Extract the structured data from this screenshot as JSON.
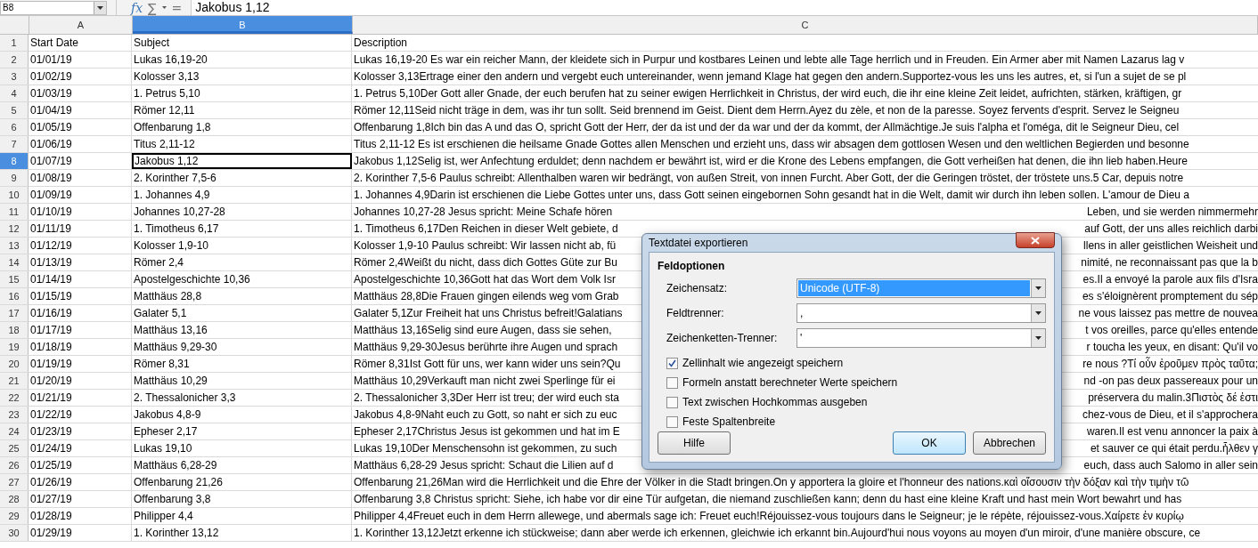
{
  "name_box": "B8",
  "formula_tools": [
    "fx",
    "∑",
    "="
  ],
  "formula": "Jakobus 1,12",
  "columns": [
    {
      "label": "A",
      "selected": false
    },
    {
      "label": "B",
      "selected": true
    },
    {
      "label": "C",
      "selected": false
    }
  ],
  "rows": [
    {
      "number": "1",
      "selected": false,
      "cells": [
        {
          "text": "Start Date",
          "selected": false
        },
        {
          "text": "Subject",
          "selected": false
        }
      ],
      "description": [
        "Description"
      ]
    },
    {
      "number": "2",
      "selected": false,
      "cells": [
        {
          "text": "01/01/19",
          "selected": false
        },
        {
          "text": "Lukas 16,19-20",
          "selected": false
        }
      ],
      "description": [
        "Lukas 16,19-20 Es war ein reicher Mann, der kleidete sich in Purpur und kostbares Leinen und lebte alle Tage herrlich und in Freuden. Ein Armer aber mit Namen Lazarus lag v"
      ]
    },
    {
      "number": "3",
      "selected": false,
      "cells": [
        {
          "text": "01/02/19",
          "selected": false
        },
        {
          "text": "Kolosser 3,13",
          "selected": false
        }
      ],
      "description": [
        "Kolosser 3,13Ertrage einer den andern und vergebt euch untereinander, wenn jemand Klage hat gegen den andern.Supportez-vous les uns les autres, et, si l'un a sujet de se pl"
      ]
    },
    {
      "number": "4",
      "selected": false,
      "cells": [
        {
          "text": "01/03/19",
          "selected": false
        },
        {
          "text": "1. Petrus 5,10",
          "selected": false
        }
      ],
      "description": [
        "1. Petrus 5,10Der Gott aller Gnade, der euch berufen hat zu seiner ewigen Herrlichkeit in Christus, der wird euch, die ihr eine kleine Zeit leidet, aufrichten, stärken, kräftigen, gr"
      ]
    },
    {
      "number": "5",
      "selected": false,
      "cells": [
        {
          "text": "01/04/19",
          "selected": false
        },
        {
          "text": "Römer 12,11",
          "selected": false
        }
      ],
      "description": [
        "Römer 12,11Seid nicht träge in dem, was ihr tun sollt. Seid brennend im Geist. Dient dem Herrn.Ayez du zèle, et non de la paresse. Soyez fervents d'esprit. Servez le Seigneu"
      ]
    },
    {
      "number": "6",
      "selected": false,
      "cells": [
        {
          "text": "01/05/19",
          "selected": false
        },
        {
          "text": "Offenbarung 1,8",
          "selected": false
        }
      ],
      "description": [
        "Offenbarung 1,8Ich bin das A und das O, spricht Gott der Herr, der da ist und der da war und der da kommt, der Allmächtige.Je suis l'alpha et l'oméga, dit le Seigneur Dieu, cel"
      ]
    },
    {
      "number": "7",
      "selected": false,
      "cells": [
        {
          "text": "01/06/19",
          "selected": false
        },
        {
          "text": "Titus 2,11-12",
          "selected": false
        }
      ],
      "description": [
        "Titus 2,11-12 Es ist erschienen die heilsame Gnade Gottes allen Menschen und erzieht uns, dass wir absagen dem gottlosen Wesen und den weltlichen Begierden und besonne"
      ]
    },
    {
      "number": "8",
      "selected": true,
      "cells": [
        {
          "text": "01/07/19",
          "selected": false
        },
        {
          "text": "Jakobus 1,12",
          "selected": true
        }
      ],
      "description": [
        "Jakobus 1,12Selig ist, wer Anfechtung erduldet; denn nachdem er bewährt ist, wird er die Krone des Lebens empfangen, die Gott verheißen hat denen, die ihn lieb haben.Heure"
      ]
    },
    {
      "number": "9",
      "selected": false,
      "cells": [
        {
          "text": "01/08/19",
          "selected": false
        },
        {
          "text": "2. Korinther 7,5-6",
          "selected": false
        }
      ],
      "description": [
        "2. Korinther 7,5-6 Paulus schreibt:  Allenthalben waren wir bedrängt, von außen Streit, von innen Furcht. Aber Gott, der die Geringen tröstet, der tröstete uns.5 Car, depuis notre"
      ]
    },
    {
      "number": "10",
      "selected": false,
      "cells": [
        {
          "text": "01/09/19",
          "selected": false
        },
        {
          "text": "1. Johannes 4,9",
          "selected": false
        }
      ],
      "description": [
        "1. Johannes 4,9Darin ist erschienen die Liebe Gottes unter uns, dass Gott seinen eingebornen Sohn gesandt hat in die Welt, damit wir durch ihn leben sollen. L'amour de Dieu a"
      ]
    },
    {
      "number": "11",
      "selected": false,
      "cells": [
        {
          "text": "01/10/19",
          "selected": false
        },
        {
          "text": "Johannes 10,27-28",
          "selected": false
        }
      ],
      "description": [
        "Johannes 10,27-28 Jesus spricht:  Meine Schafe hören",
        "Leben, und sie werden nimmermehr"
      ]
    },
    {
      "number": "12",
      "selected": false,
      "cells": [
        {
          "text": "01/11/19",
          "selected": false
        },
        {
          "text": "1. Timotheus 6,17",
          "selected": false
        }
      ],
      "description": [
        "1. Timotheus 6,17Den Reichen in dieser Welt gebiete, d",
        "auf Gott, der uns alles reichlich darbi"
      ]
    },
    {
      "number": "13",
      "selected": false,
      "cells": [
        {
          "text": "01/12/19",
          "selected": false
        },
        {
          "text": "Kolosser 1,9-10",
          "selected": false
        }
      ],
      "description": [
        "Kolosser 1,9-10 Paulus schreibt:  Wir lassen nicht ab, fü",
        "llens in aller geistlichen Weisheit und"
      ]
    },
    {
      "number": "14",
      "selected": false,
      "cells": [
        {
          "text": "01/13/19",
          "selected": false
        },
        {
          "text": "Römer 2,4",
          "selected": false
        }
      ],
      "description": [
        "Römer 2,4Weißt du nicht, dass dich Gottes Güte zur Bu",
        "nimité, ne reconnaissant pas que la b"
      ]
    },
    {
      "number": "15",
      "selected": false,
      "cells": [
        {
          "text": "01/14/19",
          "selected": false
        },
        {
          "text": "Apostelgeschichte 10,36",
          "selected": false
        }
      ],
      "description": [
        "Apostelgeschichte 10,36Gott hat das Wort dem Volk Isr",
        "es.Il a envoyé la parole aux fils d'Isra"
      ]
    },
    {
      "number": "16",
      "selected": false,
      "cells": [
        {
          "text": "01/15/19",
          "selected": false
        },
        {
          "text": "Matthäus 28,8",
          "selected": false
        }
      ],
      "description": [
        "Matthäus 28,8Die Frauen gingen eilends weg vom Grab",
        "es s'éloignèrent promptement du sép"
      ]
    },
    {
      "number": "17",
      "selected": false,
      "cells": [
        {
          "text": "01/16/19",
          "selected": false
        },
        {
          "text": "Galater 5,1",
          "selected": false
        }
      ],
      "description": [
        "Galater 5,1Zur Freiheit hat uns Christus befreit!Galatians",
        "ne vous laissez pas mettre de nouvea"
      ]
    },
    {
      "number": "18",
      "selected": false,
      "cells": [
        {
          "text": "01/17/19",
          "selected": false
        },
        {
          "text": "Matthäus 13,16",
          "selected": false
        }
      ],
      "description": [
        "Matthäus 13,16Selig sind eure Augen, dass sie sehen,",
        "t vos oreilles, parce qu'elles entende"
      ]
    },
    {
      "number": "19",
      "selected": false,
      "cells": [
        {
          "text": "01/18/19",
          "selected": false
        },
        {
          "text": "Matthäus 9,29-30",
          "selected": false
        }
      ],
      "description": [
        "Matthäus 9,29-30Jesus berührte ihre Augen und sprach",
        "r toucha les yeux, en disant: Qu'il vo"
      ]
    },
    {
      "number": "20",
      "selected": false,
      "cells": [
        {
          "text": "01/19/19",
          "selected": false
        },
        {
          "text": "Römer 8,31",
          "selected": false
        }
      ],
      "description": [
        "Römer 8,31Ist Gott für uns, wer kann wider uns sein?Qu",
        "re nous ?Τί οὖν ἐροῦμεν πρὸς ταῦτα;"
      ]
    },
    {
      "number": "21",
      "selected": false,
      "cells": [
        {
          "text": "01/20/19",
          "selected": false
        },
        {
          "text": "Matthäus 10,29",
          "selected": false
        }
      ],
      "description": [
        "Matthäus 10,29Verkauft man nicht zwei Sperlinge für ei",
        "nd -on pas deux passereaux pour un"
      ]
    },
    {
      "number": "22",
      "selected": false,
      "cells": [
        {
          "text": "01/21/19",
          "selected": false
        },
        {
          "text": "2. Thessalonicher 3,3",
          "selected": false
        }
      ],
      "description": [
        "2. Thessalonicher 3,3Der Herr ist treu; der wird euch sta",
        "préservera du malin.3Πιστὸς δέ ἐστι"
      ]
    },
    {
      "number": "23",
      "selected": false,
      "cells": [
        {
          "text": "01/22/19",
          "selected": false
        },
        {
          "text": "Jakobus 4,8-9",
          "selected": false
        }
      ],
      "description": [
        "Jakobus 4,8-9Naht euch zu Gott, so naht er sich zu euc",
        "chez-vous de Dieu, et il s'approchera"
      ]
    },
    {
      "number": "24",
      "selected": false,
      "cells": [
        {
          "text": "01/23/19",
          "selected": false
        },
        {
          "text": "Epheser 2,17",
          "selected": false
        }
      ],
      "description": [
        "Epheser 2,17Christus Jesus ist gekommen und hat im E",
        "waren.Il est venu annoncer la paix à"
      ]
    },
    {
      "number": "25",
      "selected": false,
      "cells": [
        {
          "text": "01/24/19",
          "selected": false
        },
        {
          "text": "Lukas 19,10",
          "selected": false
        }
      ],
      "description": [
        "Lukas 19,10Der Menschensohn ist gekommen, zu such",
        "et sauver ce qui était perdu.ἦλθεν γ"
      ]
    },
    {
      "number": "26",
      "selected": false,
      "cells": [
        {
          "text": "01/25/19",
          "selected": false
        },
        {
          "text": "Matthäus 6,28-29",
          "selected": false
        }
      ],
      "description": [
        "Matthäus 6,28-29 Jesus spricht:  Schaut die Lilien auf d",
        "euch, dass auch Salomo in aller sein"
      ]
    },
    {
      "number": "27",
      "selected": false,
      "cells": [
        {
          "text": "01/26/19",
          "selected": false
        },
        {
          "text": "Offenbarung 21,26",
          "selected": false
        }
      ],
      "description": [
        "Offenbarung 21,26Man wird die Herrlichkeit und die Ehre der Völker in die Stadt bringen.On y apportera la gloire et l'honneur des nations.καὶ οἴσουσιν τὴν δόξαν καὶ τὴν τιμὴν τῶ"
      ]
    },
    {
      "number": "28",
      "selected": false,
      "cells": [
        {
          "text": "01/27/19",
          "selected": false
        },
        {
          "text": "Offenbarung 3,8",
          "selected": false
        }
      ],
      "description": [
        "Offenbarung 3,8 Christus spricht:  Siehe, ich habe vor dir eine Tür aufgetan, die niemand zuschließen kann; denn du hast eine kleine Kraft und hast mein Wort bewahrt und has"
      ]
    },
    {
      "number": "29",
      "selected": false,
      "cells": [
        {
          "text": "01/28/19",
          "selected": false
        },
        {
          "text": "Philipper 4,4",
          "selected": false
        }
      ],
      "description": [
        "Philipper 4,4Freuet euch in dem Herrn allewege, und abermals sage ich: Freuet euch!Réjouissez-vous toujours dans le Seigneur; je le répète, réjouissez-vous.Χαίρετε ἐν κυρίῳ"
      ]
    },
    {
      "number": "30",
      "selected": false,
      "cells": [
        {
          "text": "01/29/19",
          "selected": false
        },
        {
          "text": "1. Korinther 13,12",
          "selected": false
        }
      ],
      "description": [
        "1. Korinther 13,12Jetzt erkenne ich stückweise; dann aber werde ich erkennen, gleichwie ich erkannt bin.Aujourd'hui nous voyons au moyen d'un miroir, d'une manière obscure, ce"
      ]
    }
  ],
  "dialog": {
    "title": "Textdatei exportieren",
    "section": "Feldoptionen",
    "fields": [
      {
        "label": "Zeichensatz:",
        "value": "Unicode (UTF-8)",
        "selected": true
      },
      {
        "label": "Feldtrenner:",
        "value": ",",
        "selected": false
      },
      {
        "label": "Zeichenketten-Trenner:",
        "value": "'",
        "selected": false
      }
    ],
    "checkboxes": [
      {
        "label": "Zellinhalt wie angezeigt speichern",
        "checked": true
      },
      {
        "label": "Formeln anstatt berechneter Werte speichern",
        "checked": false
      },
      {
        "label": "Text zwischen Hochkommas ausgeben",
        "checked": false
      },
      {
        "label": "Feste Spaltenbreite",
        "checked": false
      }
    ],
    "buttons": [
      {
        "label": "Hilfe",
        "kind": "help"
      },
      {
        "label": "OK",
        "kind": "default"
      },
      {
        "label": "Abbrechen",
        "kind": "cancel"
      }
    ]
  }
}
